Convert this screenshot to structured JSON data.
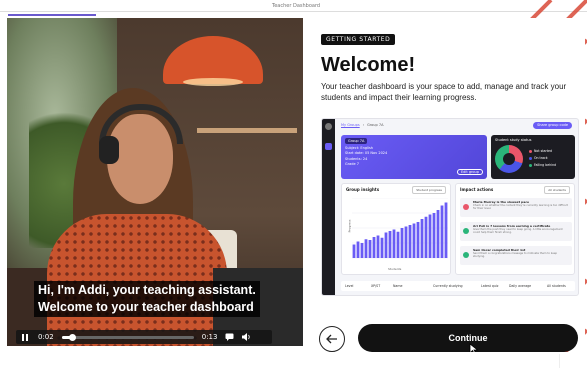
{
  "topbar": {
    "brand": "Teacher Dashboard"
  },
  "colors": {
    "accent": "#6a5cf5",
    "dark": "#121212",
    "pattern": "#d94a38"
  },
  "video": {
    "caption_line1": "Hi, I'm Addi, your teaching assistant.",
    "caption_line2": "Welcome to your teacher dashboard",
    "time_current": "0:02",
    "time_total": "0:13",
    "progress_fraction": 0.08,
    "icons": {
      "play": "pause-icon",
      "captions": "captions-icon",
      "volume": "volume-icon"
    }
  },
  "onboarding": {
    "pill": "GETTING STARTED",
    "title": "Welcome!",
    "description": "Your teacher dashboard is your space to add, manage and track your students and impact their learning progress.",
    "back_icon": "arrow-left-icon",
    "continue_label": "Continue"
  },
  "preview": {
    "breadcrumb_link": "My Groups",
    "breadcrumb_current": "Group 7A",
    "top_button": "Share group code",
    "group_card": {
      "heading": "Group 7A",
      "rows": [
        "Subject: English",
        "Start date: 05 Nov 2024",
        "Students: 24",
        "Grade 7"
      ],
      "view_button": "Edit group"
    },
    "status": {
      "heading": "Student study status",
      "legend": [
        "Not started",
        "On track",
        "Falling behind"
      ]
    },
    "insights": {
      "heading": "Group insights",
      "selector": "Student progress",
      "ylabel": "Progress",
      "xlabel": "Students",
      "bars": [
        18,
        22,
        20,
        25,
        24,
        28,
        30,
        27,
        34,
        36,
        38,
        35,
        40,
        42,
        44,
        46,
        48,
        52,
        55,
        58,
        60,
        64,
        70,
        74
      ]
    },
    "actions": {
      "heading": "Impact actions",
      "selector": "All students",
      "items": [
        {
          "title": "Maria Murray is the slowest pace",
          "desc": "Check in on whether the content they're currently learning is too difficult for their level.",
          "color": "#e9566a"
        },
        {
          "title": "Ari Poli is 7 lessons from earning a certificate",
          "desc": "Give them the push they need to keep going. A little encouragement could help them finish strong.",
          "color": "#2bb57a"
        },
        {
          "title": "Sam Oscar completed their 1st",
          "desc": "Send them a congratulations message to motivate them to keep studying.",
          "color": "#2bb57a"
        }
      ]
    },
    "footer_cols": [
      "Level",
      "XP/ST",
      "Name",
      "Currently studying",
      "Latest quiz",
      "Daily average"
    ],
    "footer_selector": "All students"
  }
}
